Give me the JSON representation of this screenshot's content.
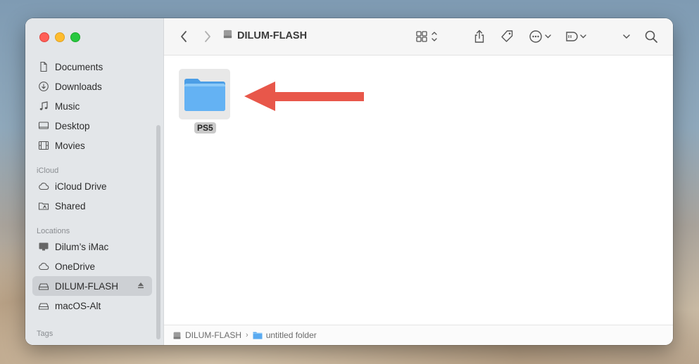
{
  "window": {
    "title": "DILUM-FLASH"
  },
  "sidebar": {
    "favorites": [
      {
        "label": "Documents",
        "icon": "document-icon"
      },
      {
        "label": "Downloads",
        "icon": "download-icon"
      },
      {
        "label": "Music",
        "icon": "music-note-icon"
      },
      {
        "label": "Desktop",
        "icon": "desktop-icon"
      },
      {
        "label": "Movies",
        "icon": "film-icon"
      }
    ],
    "icloud_header": "iCloud",
    "icloud": [
      {
        "label": "iCloud Drive",
        "icon": "cloud-icon"
      },
      {
        "label": "Shared",
        "icon": "shared-folder-icon"
      }
    ],
    "locations_header": "Locations",
    "locations": [
      {
        "label": "Dilum’s iMac",
        "icon": "imac-icon"
      },
      {
        "label": "OneDrive",
        "icon": "cloud-icon"
      },
      {
        "label": "DILUM-FLASH",
        "icon": "drive-icon",
        "selected": true,
        "ejectable": true
      },
      {
        "label": "macOS-Alt",
        "icon": "drive-icon"
      }
    ],
    "tags_header": "Tags"
  },
  "content": {
    "items": [
      {
        "name": "PS5",
        "kind": "folder",
        "selected": true
      }
    ]
  },
  "pathbar": {
    "segments": [
      {
        "label": "DILUM-FLASH",
        "icon": "drive-icon"
      },
      {
        "label": "untitled folder",
        "icon": "folder-icon"
      }
    ]
  },
  "colors": {
    "arrow": "#e8574a",
    "folder": "#5aaaf0",
    "selection": "#cdd0d4"
  }
}
